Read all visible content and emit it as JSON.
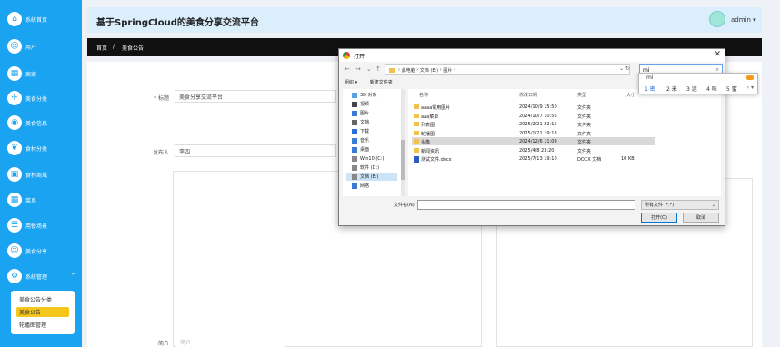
{
  "sidebar": {
    "items": [
      {
        "label": "系统首页",
        "icon": "home-icon"
      },
      {
        "label": "用户",
        "icon": "user-icon"
      },
      {
        "label": "商家",
        "icon": "shop-icon"
      },
      {
        "label": "美食分类",
        "icon": "category-icon"
      },
      {
        "label": "美食信息",
        "icon": "food-icon"
      },
      {
        "label": "食材分类",
        "icon": "ingredient-category-icon"
      },
      {
        "label": "食材商城",
        "icon": "mall-icon"
      },
      {
        "label": "菜系",
        "icon": "cuisine-icon"
      },
      {
        "label": "用餐场景",
        "icon": "scene-icon"
      },
      {
        "label": "美食分享",
        "icon": "share-icon"
      },
      {
        "label": "系统管理",
        "icon": "settings-icon"
      }
    ],
    "submenu": [
      "美食公告分类",
      "美食公告",
      "轮播图管理"
    ],
    "submenu_active_index": 1,
    "accent_color": "#1aa3f0",
    "active_color": "#f5c61b"
  },
  "header": {
    "title": "基于SpringCloud的美食分享交流平台",
    "user": "admin",
    "caret": "▾"
  },
  "breadcrumb": {
    "home": "首页",
    "separator": "/",
    "current": "美食公告"
  },
  "form": {
    "title_label": "* 标题",
    "title_value": "美食分享交流平台",
    "publisher_label": "发布人",
    "publisher_value": "李四",
    "intro_label": "简介",
    "intro_placeholder": "简介"
  },
  "file_dialog": {
    "title": "打开",
    "close": "✕",
    "path": [
      "此电脑",
      "文档 (E:)",
      "图片"
    ],
    "path_sep": "›",
    "search_value": "mi",
    "toolbar": [
      "组织 ▾",
      "新建文件夹"
    ],
    "nav_items": [
      "3D 对象",
      "视频",
      "图片",
      "文档",
      "下载",
      "音乐",
      "桌面",
      "Win10 (C:)",
      "软件 (D:)",
      "文档 (E:)",
      "网络"
    ],
    "nav_selected_index": 9,
    "columns": [
      "名称",
      "修改日期",
      "类型",
      "大小"
    ],
    "files": [
      {
        "name": "aaaa常用图片",
        "date": "2024/10/9 15:50",
        "type": "文件夹",
        "size": "",
        "kind": "folder"
      },
      {
        "name": "aaa菜单",
        "date": "2024/10/7 10:56",
        "type": "文件夹",
        "size": "",
        "kind": "folder"
      },
      {
        "name": "列表图",
        "date": "2025/2/21 22:15",
        "type": "文件夹",
        "size": "",
        "kind": "folder"
      },
      {
        "name": "轮播图",
        "date": "2025/1/21 19:18",
        "type": "文件夹",
        "size": "",
        "kind": "folder"
      },
      {
        "name": "头像",
        "date": "2024/12/6 11:09",
        "type": "文件夹",
        "size": "",
        "kind": "folder"
      },
      {
        "name": "新闻资讯",
        "date": "2025/4/8 23:20",
        "type": "文件夹",
        "size": "",
        "kind": "folder"
      },
      {
        "name": "测试文件.docx",
        "date": "2025/7/13 19:10",
        "type": "DOCX 文档",
        "size": "10 KB",
        "kind": "doc"
      }
    ],
    "selected_file_index": 4,
    "filename_label": "文件名(N):",
    "filetype_value": "所有文件 (*.*)",
    "open_button": "打开(O)",
    "cancel_button": "取消"
  },
  "ime": {
    "composition": "mi",
    "candidates": [
      "1 密",
      "2 米",
      "3 迷",
      "4 咪",
      "5 蜜"
    ],
    "more": "› ▾"
  }
}
